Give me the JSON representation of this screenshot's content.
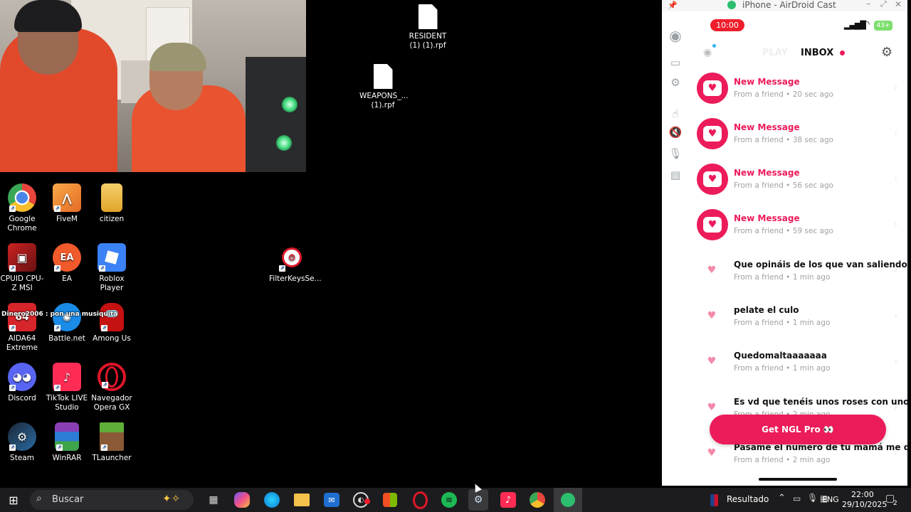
{
  "desktop": {
    "icons": [
      {
        "label": "Google Chrome",
        "icon": "chrome-icon"
      },
      {
        "label": "FiveM",
        "icon": "fivem-icon"
      },
      {
        "label": "citizen",
        "icon": "folder-icon"
      },
      {
        "label": "CPUID CPU-Z MSI",
        "icon": "cpuz-icon"
      },
      {
        "label": "EA",
        "icon": "ea-icon"
      },
      {
        "label": "Roblox Player",
        "icon": "roblox-icon"
      },
      {
        "label": "AIDA64 Extreme",
        "icon": "aida64-icon"
      },
      {
        "label": "Battle.net",
        "icon": "battlenet-icon"
      },
      {
        "label": "Among Us",
        "icon": "among-us-icon"
      },
      {
        "label": "Discord",
        "icon": "discord-icon"
      },
      {
        "label": "TikTok LIVE Studio",
        "icon": "tiktok-icon"
      },
      {
        "label": "Navegador Opera GX",
        "icon": "opera-gx-icon"
      },
      {
        "label": "Steam",
        "icon": "steam-icon"
      },
      {
        "label": "WinRAR",
        "icon": "winrar-icon"
      },
      {
        "label": "TLauncher",
        "icon": "tlauncher-icon"
      },
      {
        "label": "FilterKeysSe...",
        "icon": "filterkeys-icon"
      }
    ],
    "files": [
      {
        "label": "RESIDENT (1) (1).rpf"
      },
      {
        "label": "WEAPONS_... (1).rpf"
      }
    ],
    "chat_overlay": "Dinero2006 : pon una musiquita"
  },
  "airdroid": {
    "title": "iPhone - AirDroid Cast",
    "phone": {
      "time": "10:00",
      "battery": "43+",
      "tabs": {
        "play": "PLAY",
        "inbox": "INBOX"
      },
      "messages": [
        {
          "title": "New Message",
          "sub": "From a friend • 20 sec ago",
          "highlight": true
        },
        {
          "title": "New Message",
          "sub": "From a friend • 38 sec ago",
          "highlight": true
        },
        {
          "title": "New Message",
          "sub": "From a friend • 56 sec ago",
          "highlight": true
        },
        {
          "title": "New Message",
          "sub": "From a friend • 59 sec ago",
          "highlight": true
        },
        {
          "title": "Que opináis de los que van saliendo...",
          "sub": "From a friend • 1 min ago",
          "highlight": false
        },
        {
          "title": "pelate el culo",
          "sub": "From a friend • 1 min ago",
          "highlight": false
        },
        {
          "title": "Quedomaltaaaaaaa",
          "sub": "From a friend • 1 min ago",
          "highlight": false
        },
        {
          "title": "Es vd que tenéis unos roses con unos...",
          "sub": "From a friend • 2 min ago",
          "highlight": false
        },
        {
          "title": "Pásame el número de tu mamá me qu...",
          "sub": "From a friend • 2 min ago",
          "highlight": false
        }
      ],
      "cta": "Get NGL Pro 👀"
    }
  },
  "taskbar": {
    "search_placeholder": "Buscar",
    "weather_label": "Resultado",
    "lang": "ENG",
    "time": "22:00",
    "date": "29/10/2025",
    "notif_count": "2"
  },
  "colors": {
    "ngl_pink": "#ec1b5a",
    "recording_red": "#f01e2c"
  }
}
